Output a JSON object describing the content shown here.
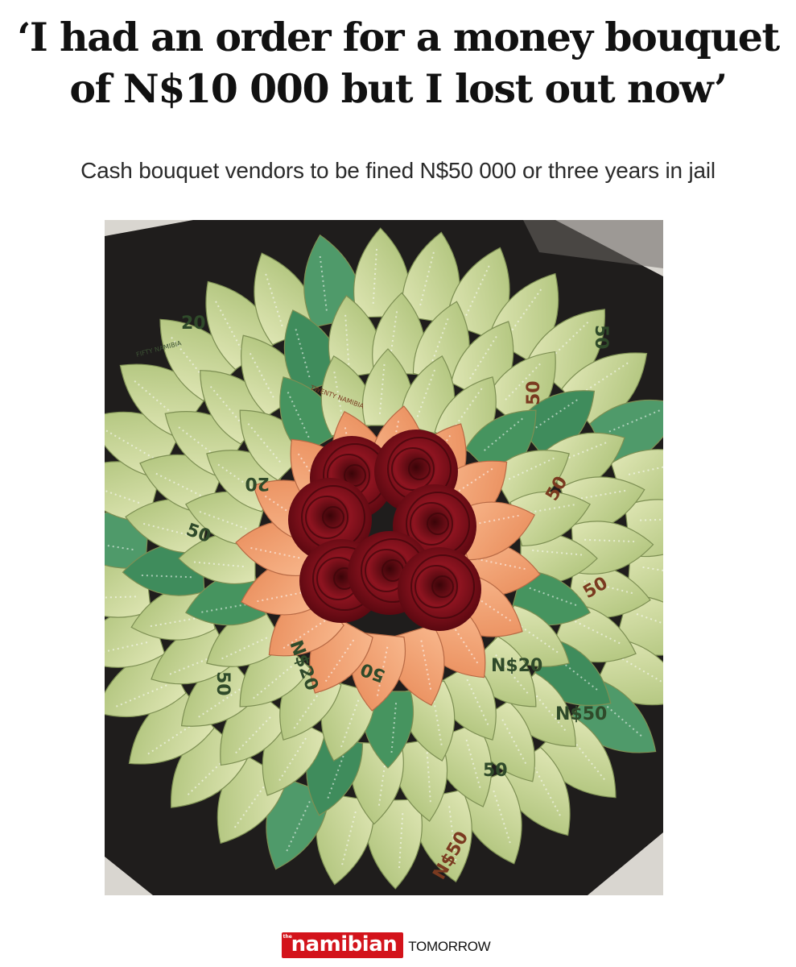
{
  "headline": {
    "line1": "‘I had an order for a money bouquet",
    "line2": "of N$10 000 but I lost out now’"
  },
  "subheadline": "Cash bouquet vendors to be fined N$50 000 or three years in jail",
  "photo": {
    "description_icon": "money-bouquet-photo",
    "visible_note_labels": [
      "50",
      "20",
      "N$50",
      "N$20",
      "FIFTY NAMIBIA",
      "TWENTY NAMIBIA"
    ]
  },
  "footer": {
    "logo_small": "the",
    "logo_text": "namibian",
    "edition": "TOMORROW"
  },
  "colors": {
    "headline": "#111111",
    "logo_red": "#d3131b",
    "note_green": "#c9d79a",
    "note_orange": "#f3a072",
    "rose_red": "#7c0d16",
    "wrap_dark": "#1d1c1b"
  }
}
